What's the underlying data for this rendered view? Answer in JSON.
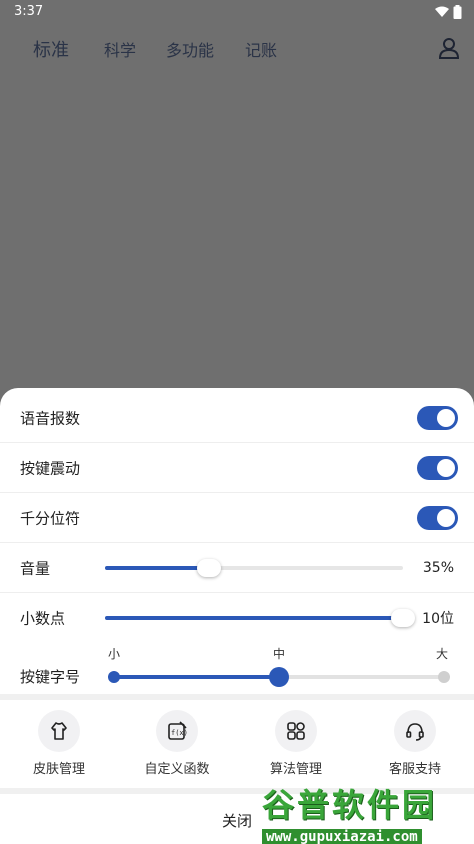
{
  "status": {
    "time": "3:37"
  },
  "nav": {
    "tabs": [
      {
        "label": "标准"
      },
      {
        "label": "科学"
      },
      {
        "label": "多功能"
      },
      {
        "label": "记账"
      }
    ]
  },
  "settings": {
    "voice_label": "语音报数",
    "voice_on": true,
    "vibrate_label": "按键震动",
    "vibrate_on": true,
    "thousands_label": "千分位符",
    "thousands_on": true,
    "volume_label": "音量",
    "volume_value": "35%",
    "volume_fraction": 0.35,
    "decimal_label": "小数点",
    "decimal_value": "10位",
    "decimal_fraction": 1.0,
    "keysize_label": "按键字号",
    "keysize_marks": [
      "小",
      "中",
      "大"
    ],
    "keysize_selected": "中"
  },
  "tools": [
    {
      "label": "皮肤管理",
      "icon": "skin-icon"
    },
    {
      "label": "自定义函数",
      "icon": "function-icon"
    },
    {
      "label": "算法管理",
      "icon": "algorithm-icon"
    },
    {
      "label": "客服支持",
      "icon": "headset-icon"
    }
  ],
  "close_label": "关闭",
  "watermark": {
    "line1": "谷普软件园",
    "line2": "www.gupuxiazai.com"
  },
  "colors": {
    "accent": "#2b58b7",
    "overlay": "#6f6f6f"
  }
}
